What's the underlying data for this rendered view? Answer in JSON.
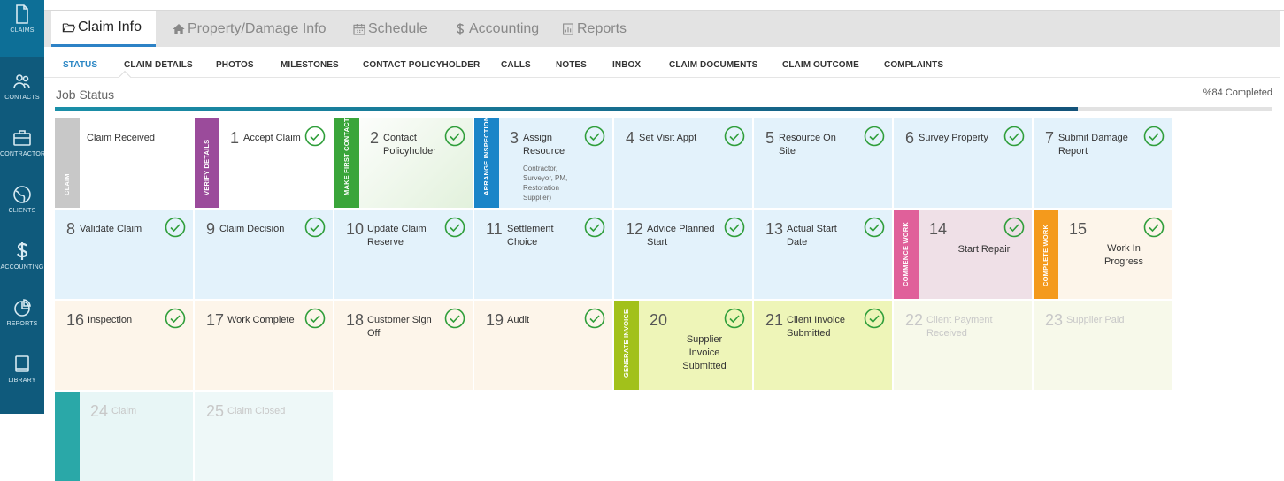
{
  "sidebar": {
    "items": [
      {
        "label": "CLAIMS",
        "icon": "document-icon",
        "active": true
      },
      {
        "label": "CONTACTS",
        "icon": "contacts-icon"
      },
      {
        "label": "CONTRACTORS",
        "icon": "briefcase-icon"
      },
      {
        "label": "CLIENTS",
        "icon": "globe-icon"
      },
      {
        "label": "ACCOUNTING",
        "icon": "dollar-icon"
      },
      {
        "label": "REPORTS",
        "icon": "pie-chart-icon"
      },
      {
        "label": "LIBRARY",
        "icon": "book-icon"
      }
    ]
  },
  "tabs": [
    {
      "label": "Claim Info",
      "icon": "folder-open-icon",
      "active": true
    },
    {
      "label": "Property/Damage Info",
      "icon": "home-icon"
    },
    {
      "label": "Schedule",
      "icon": "calendar-icon"
    },
    {
      "label": "Accounting",
      "icon": "dollar-icon"
    },
    {
      "label": "Reports",
      "icon": "report-icon"
    }
  ],
  "subtabs": [
    "STATUS",
    "CLAIM DETAILS",
    "PHOTOS",
    "MILESTONES",
    "CONTACT POLICYHOLDER",
    "CALLS",
    "NOTES",
    "INBOX",
    "CLAIM DOCUMENTS",
    "CLAIM OUTCOME",
    "COMPLAINTS"
  ],
  "job_status": {
    "title": "Job Status",
    "completed_text": "%84 Completed",
    "progress": 0.84
  },
  "steps": [
    {
      "num": "",
      "label": "Claim Received",
      "band": "CLAIM",
      "band_color": "#c8c8c8",
      "bg": "#ffffff",
      "done": false,
      "faded": false
    },
    {
      "num": "1",
      "label": "Accept Claim",
      "band": "VERIFY DETAILS",
      "band_color": "#9b4b9b",
      "bg": "#ffffff",
      "done": true,
      "faded": false
    },
    {
      "num": "2",
      "label": "Contact Policyholder",
      "band": "MAKE FIRST CONTACT",
      "band_color": "#3aa53a",
      "bg": "#ecf6e8",
      "done": true,
      "faded": false
    },
    {
      "num": "3",
      "label": "Assign Resource",
      "sub": "Contractor, Surveyor, PM, Restoration Supplier)",
      "band": "ARRANGE INSPECTION",
      "band_color": "#1a85c8",
      "bg": "#e3f2fb",
      "done": true,
      "faded": false
    },
    {
      "num": "4",
      "label": "Set Visit Appt",
      "band": "",
      "bg": "#e3f2fb",
      "done": true,
      "faded": false
    },
    {
      "num": "5",
      "label": "Resource On Site",
      "band": "",
      "bg": "#e3f2fb",
      "done": true,
      "faded": false
    },
    {
      "num": "6",
      "label": "Survey Property",
      "band": "",
      "bg": "#e3f2fb",
      "done": true,
      "faded": false
    },
    {
      "num": "7",
      "label": "Submit Damage Report",
      "band": "",
      "bg": "#e3f2fb",
      "done": true,
      "faded": false
    },
    {
      "num": "8",
      "label": "Validate Claim",
      "band": "",
      "bg": "#e3f2fb",
      "done": true,
      "faded": false
    },
    {
      "num": "9",
      "label": "Claim Decision",
      "band": "",
      "bg": "#e3f2fb",
      "done": true,
      "faded": false
    },
    {
      "num": "10",
      "label": "Update Claim Reserve",
      "band": "",
      "bg": "#e3f2fb",
      "done": true,
      "faded": false
    },
    {
      "num": "11",
      "label": "Settlement Choice",
      "band": "",
      "bg": "#e3f2fb",
      "done": true,
      "faded": false
    },
    {
      "num": "12",
      "label": "Advice Planned Start",
      "band": "",
      "bg": "#e3f2fb",
      "done": true,
      "faded": false
    },
    {
      "num": "13",
      "label": "Actual Start Date",
      "band": "",
      "bg": "#e3f2fb",
      "done": true,
      "faded": false
    },
    {
      "num": "14",
      "label": "Start Repair",
      "band": "COMMENCE WORK",
      "band_color": "#e0609a",
      "bg": "#efe0e7",
      "done": true,
      "faded": false
    },
    {
      "num": "15",
      "label": "Work In Progress",
      "band": "COMPLETE WORK",
      "band_color": "#f49a1c",
      "bg": "#fdf5ea",
      "done": true,
      "faded": false
    },
    {
      "num": "16",
      "label": "Inspection",
      "band": "",
      "bg": "#fdf5ea",
      "done": true,
      "faded": false
    },
    {
      "num": "17",
      "label": "Work Complete",
      "band": "",
      "bg": "#fdf5ea",
      "done": true,
      "faded": false
    },
    {
      "num": "18",
      "label": "Customer Sign Off",
      "band": "",
      "bg": "#fdf5ea",
      "done": true,
      "faded": false
    },
    {
      "num": "19",
      "label": "Audit",
      "band": "",
      "bg": "#fdf5ea",
      "done": true,
      "faded": false
    },
    {
      "num": "20",
      "label": "Supplier Invoice Submitted",
      "band": "GENERATE INVOICE",
      "band_color": "#a2c11b",
      "bg": "#eef5b8",
      "done": true,
      "faded": false
    },
    {
      "num": "21",
      "label": "Client Invoice Submitted",
      "band": "",
      "bg": "#eef5b8",
      "done": true,
      "faded": false
    },
    {
      "num": "22",
      "label": "Client Payment Received",
      "band": "",
      "bg": "#f7f9ea",
      "done": false,
      "faded": true
    },
    {
      "num": "23",
      "label": "Supplier Paid",
      "band": "",
      "bg": "#f7f9ea",
      "done": false,
      "faded": true
    },
    {
      "num": "24",
      "label": "Claim",
      "band": "",
      "band_color": "#2aa8a8",
      "bg": "#e8f6f6",
      "done": false,
      "faded": true
    },
    {
      "num": "25",
      "label": "Claim Closed",
      "band": "",
      "bg": "#eef8f8",
      "done": false,
      "faded": true
    }
  ],
  "colors": {
    "check": "#2f9e3a",
    "accent": "#2d82c6",
    "sidebar": "#0f5a7c"
  }
}
